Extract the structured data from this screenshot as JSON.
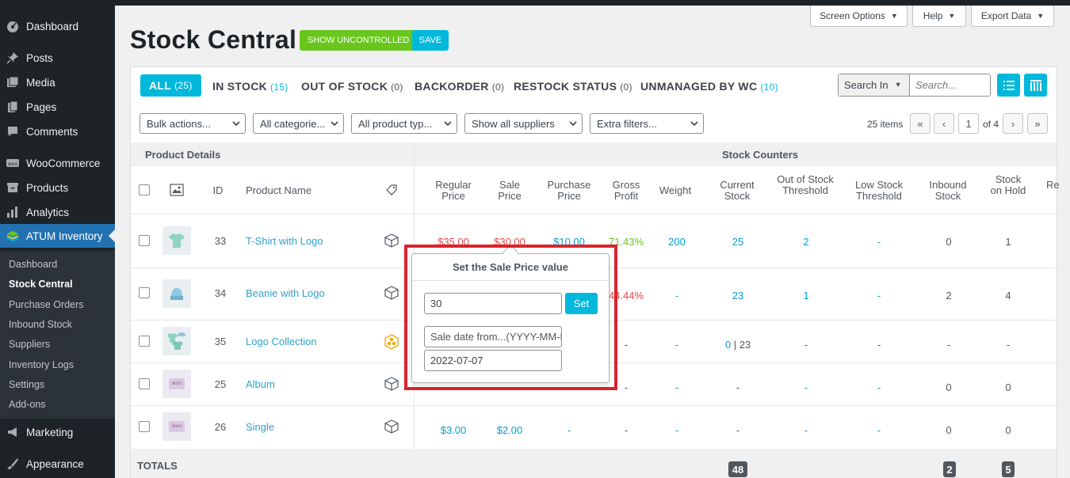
{
  "sidebar": {
    "items": [
      {
        "label": "Dashboard",
        "icon": "dashboard-icon"
      },
      {
        "label": "Posts",
        "icon": "pin-icon"
      },
      {
        "label": "Media",
        "icon": "media-icon"
      },
      {
        "label": "Pages",
        "icon": "pages-icon"
      },
      {
        "label": "Comments",
        "icon": "comments-icon"
      },
      {
        "label": "WooCommerce",
        "icon": "woocommerce-icon"
      },
      {
        "label": "Products",
        "icon": "products-icon"
      },
      {
        "label": "Analytics",
        "icon": "analytics-icon"
      },
      {
        "label": "ATUM Inventory",
        "icon": "atum-icon"
      },
      {
        "label": "Marketing",
        "icon": "marketing-icon"
      },
      {
        "label": "Appearance",
        "icon": "appearance-icon"
      }
    ],
    "submenu": [
      "Dashboard",
      "Stock Central",
      "Purchase Orders",
      "Inbound Stock",
      "Suppliers",
      "Inventory Logs",
      "Settings",
      "Add-ons"
    ]
  },
  "header": {
    "title": "Stock Central",
    "show_uncontrolled": "SHOW UNCONTROLLED",
    "save": "SAVE",
    "screen_options": "Screen Options",
    "help": "Help",
    "export_data": "Export Data"
  },
  "views": {
    "all": {
      "label": "ALL",
      "count": "(25)"
    },
    "in_stock": {
      "label": "IN STOCK",
      "count": "(15)"
    },
    "out_of_stock": {
      "label": "OUT OF STOCK",
      "count": "(0)"
    },
    "backorder": {
      "label": "BACKORDER",
      "count": "(0)"
    },
    "restock": {
      "label": "RESTOCK STATUS",
      "count": "(0)"
    },
    "unmanaged": {
      "label": "UNMANAGED BY WC",
      "count": "(10)"
    }
  },
  "search": {
    "search_in": "Search In",
    "placeholder": "Search..."
  },
  "filters": {
    "bulk": "Bulk actions...",
    "categories": "All categorie...",
    "product_types": "All product typ...",
    "suppliers": "Show all suppliers",
    "extra": "Extra filters..."
  },
  "pagination": {
    "items": "25 items",
    "first": "«",
    "prev": "‹",
    "current": "1",
    "of": "of 4",
    "next": "›",
    "last": "»"
  },
  "table": {
    "group_left": "Product Details",
    "group_right": "Stock Counters",
    "headers": {
      "id": "ID",
      "name": "Product Name",
      "regular": "Regular Price",
      "sale": "Sale Price",
      "purchase": "Purchase Price",
      "gross": "Gross Profit",
      "weight": "Weight",
      "current": "Current Stock",
      "out_threshold": "Out of Stock Threshold",
      "low_threshold": "Low Stock Threshold",
      "inbound": "Inbound Stock",
      "hold": "Stock on Hold",
      "cutoff": "Re"
    },
    "rows": [
      {
        "id": "33",
        "name": "T-Shirt with Logo",
        "regular": "$35.00",
        "sale": "$30.00",
        "purchase": "$10.00",
        "gross": "71.43%",
        "weight": "200",
        "current": "25",
        "out_threshold": "2",
        "low_threshold": "-",
        "inbound": "0",
        "hold": "1"
      },
      {
        "id": "34",
        "name": "Beanie with Logo",
        "gross": "44.44%",
        "weight": "-",
        "current": "23",
        "out_threshold": "1",
        "low_threshold": "-",
        "inbound": "2",
        "hold": "4"
      },
      {
        "id": "35",
        "name": "Logo Collection",
        "gross": "-",
        "weight": "-",
        "current_a": "0",
        "current_sep": " | ",
        "current_b": "23",
        "out_threshold": "-",
        "low_threshold": "-",
        "inbound": "-",
        "hold": "-"
      },
      {
        "id": "25",
        "name": "Album",
        "gross": "-",
        "weight": "-",
        "current": "-",
        "out_threshold": "-",
        "low_threshold": "-",
        "inbound": "0",
        "hold": "0"
      },
      {
        "id": "26",
        "name": "Single",
        "regular": "$3.00",
        "sale": "$2.00",
        "purchase": "-",
        "gross": "-",
        "weight": "-",
        "current": "-",
        "out_threshold": "-",
        "low_threshold": "-",
        "inbound": "0",
        "hold": "0"
      }
    ],
    "totals": {
      "label": "TOTALS",
      "current": "48",
      "inbound": "2",
      "hold": "5"
    }
  },
  "popover": {
    "title": "Set the Sale Price value",
    "value": "30",
    "set": "Set",
    "date_from_placeholder": "Sale date from...(YYYY-MM-DD)",
    "date_to": "2022-07-07"
  }
}
